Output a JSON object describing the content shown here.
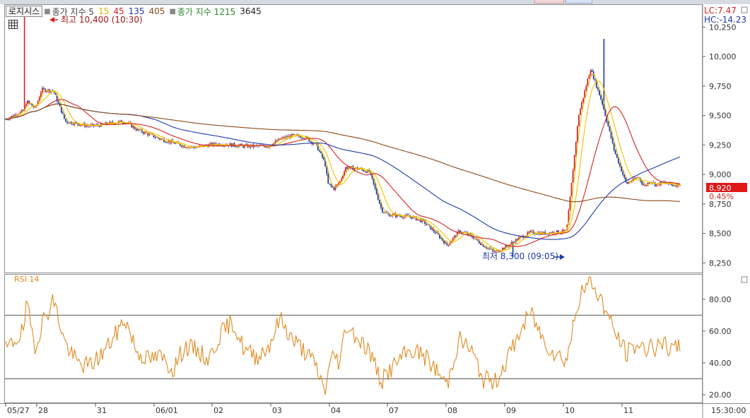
{
  "legend": {
    "title": "로지시스",
    "price_label": "종가 지수 5",
    "ma": [
      "15",
      "45",
      "135",
      "405"
    ],
    "vol_label": "종가 지수 1215",
    "vol_value": "3645"
  },
  "colors": {
    "up": "#d42424",
    "down": "#1f3aa8",
    "ma5": "#f2c200",
    "ma15": "#f2c200",
    "ma45": "#d42424",
    "ma135": "#1f3aa8",
    "ma405": "#8a4a1a",
    "rsi": "#e08a20",
    "price_box": "#e01818"
  },
  "right_panel": {
    "lc": "LC:7.47",
    "hc": "HC:-14.23",
    "current_price": "8,920",
    "current_change": "0.45%"
  },
  "annotations": {
    "high": "최고 10,400 (10:30)",
    "low": "최저 8,300 (09:05)"
  },
  "rsi_panel": {
    "title": "RSI 14",
    "levels": [
      70,
      30
    ]
  },
  "chart_data": [
    {
      "type": "candlestick",
      "title": "로지시스",
      "yticks": [
        10250,
        10000,
        9750,
        9500,
        9250,
        9000,
        8750,
        8500,
        8250
      ],
      "ytick_labels": [
        "10,250",
        "10,000",
        "9,750",
        "9,500",
        "9,250",
        "9,000",
        "8,750",
        "8,500",
        "8,250"
      ],
      "ylim": [
        8180,
        10420
      ],
      "xticks": [
        "05/27",
        "28",
        "31",
        "06/01",
        "02",
        "03",
        "04",
        "07",
        "08",
        "09",
        "10",
        "11",
        "15:30:00"
      ],
      "x_points": [
        0,
        6,
        7,
        10,
        12,
        16,
        20,
        24,
        28,
        32,
        36,
        40,
        44,
        48,
        52,
        56,
        60,
        64,
        68,
        72,
        76,
        80,
        84,
        88,
        92,
        96,
        100,
        104,
        107,
        108,
        110,
        112,
        114,
        118,
        122,
        126,
        128,
        132,
        136,
        140,
        144,
        148,
        150,
        152,
        156,
        160,
        164,
        168,
        172,
        176,
        180,
        184,
        188,
        192,
        196,
        200,
        204,
        208,
        212,
        214,
        215,
        216,
        217,
        218,
        219,
        220,
        222,
        224,
        226
      ],
      "close_values": [
        9470,
        9540,
        9620,
        9560,
        9720,
        9710,
        9450,
        9430,
        9410,
        9420,
        9440,
        9450,
        9380,
        9340,
        9300,
        9270,
        9240,
        9230,
        9250,
        9260,
        9250,
        9240,
        9240,
        9240,
        9300,
        9330,
        9320,
        9250,
        9100,
        8920,
        8880,
        8940,
        9060,
        9050,
        9020,
        8700,
        8660,
        8650,
        8640,
        8600,
        8510,
        8400,
        8460,
        8520,
        8480,
        8400,
        8340,
        8390,
        8460,
        8510,
        8500,
        8510,
        8520,
        9500,
        9900,
        9600,
        9200,
        8920,
        8980,
        8900,
        8920,
        8950,
        8930,
        8910,
        8920,
        8930,
        8920,
        8910,
        8920
      ],
      "high": {
        "value": 10400,
        "label": "최고 10,400 (10:30)"
      },
      "low": {
        "value": 8300,
        "label": "최저 8,300 (09:05)"
      },
      "series": [
        {
          "name": "5",
          "color": "#f2c200"
        },
        {
          "name": "15",
          "color": "#f2c200"
        },
        {
          "name": "45",
          "color": "#d42424"
        },
        {
          "name": "135",
          "color": "#1f3aa8"
        },
        {
          "name": "405",
          "color": "#8a4a1a"
        }
      ],
      "last_price": 8920,
      "last_change": "0.45%"
    },
    {
      "type": "line",
      "title": "RSI 14",
      "yticks": [
        80,
        60,
        40,
        20
      ],
      "ytick_labels": [
        "80.00",
        "60.00",
        "40.00",
        "20.00"
      ],
      "ylim": [
        16,
        95
      ],
      "hlines": [
        70,
        30
      ],
      "x_points": [
        0,
        6,
        7,
        10,
        12,
        16,
        20,
        24,
        28,
        32,
        36,
        40,
        44,
        48,
        52,
        56,
        60,
        64,
        68,
        72,
        76,
        80,
        84,
        88,
        92,
        96,
        100,
        104,
        107,
        108,
        110,
        112,
        114,
        118,
        122,
        126,
        128,
        132,
        136,
        140,
        144,
        148,
        150,
        152,
        156,
        160,
        164,
        168,
        172,
        176,
        180,
        184,
        188,
        192,
        196,
        200,
        204,
        208,
        212,
        214,
        215,
        216,
        217,
        218,
        219,
        220,
        222,
        224,
        226
      ],
      "values": [
        48,
        60,
        76,
        50,
        64,
        80,
        52,
        40,
        38,
        45,
        55,
        68,
        47,
        42,
        44,
        36,
        50,
        48,
        42,
        58,
        66,
        48,
        44,
        50,
        68,
        55,
        48,
        38,
        22,
        34,
        46,
        40,
        64,
        56,
        47,
        28,
        34,
        42,
        48,
        45,
        36,
        26,
        42,
        55,
        48,
        30,
        28,
        42,
        58,
        72,
        55,
        46,
        42,
        80,
        92,
        78,
        60,
        46,
        52,
        48,
        50,
        53,
        51,
        48,
        50,
        52,
        49,
        48,
        50
      ],
      "line_name": "RSI 14"
    }
  ]
}
